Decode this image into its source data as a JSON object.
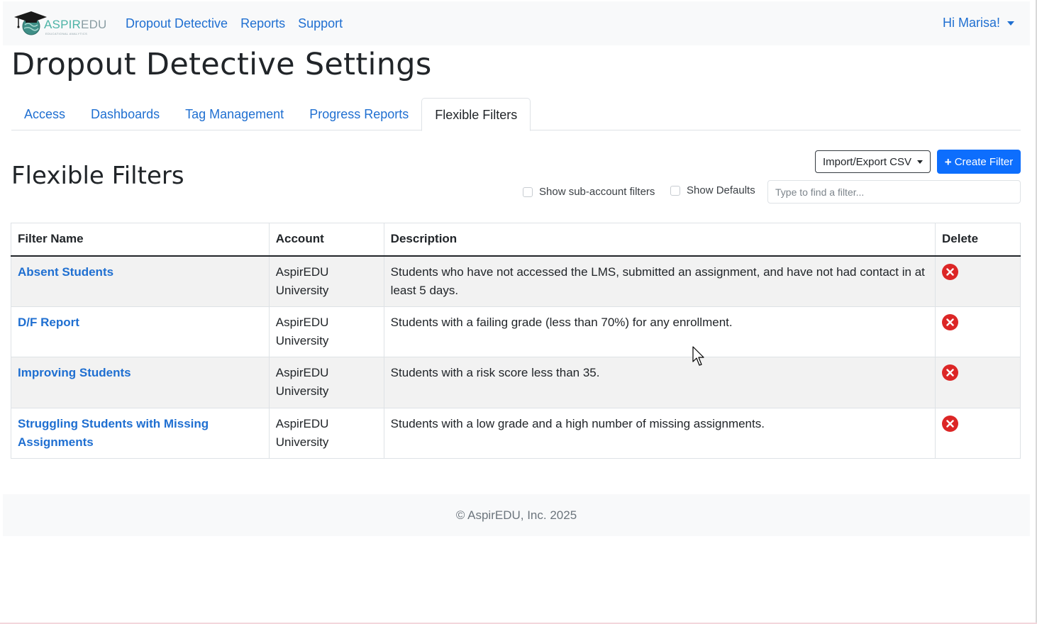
{
  "navbar": {
    "brand": {
      "part1": "ASPIR",
      "part2": "EDU",
      "tagline": "EDUCATIONAL ANALYTICS"
    },
    "links": [
      {
        "label": "Dropout Detective"
      },
      {
        "label": "Reports"
      },
      {
        "label": "Support"
      }
    ],
    "user_greeting": "Hi Marisa!"
  },
  "page_title": "Dropout Detective Settings",
  "tabs": [
    {
      "label": "Access",
      "active": false
    },
    {
      "label": "Dashboards",
      "active": false
    },
    {
      "label": "Tag Management",
      "active": false
    },
    {
      "label": "Progress Reports",
      "active": false
    },
    {
      "label": "Flexible Filters",
      "active": true
    }
  ],
  "section": {
    "title": "Flexible Filters",
    "import_export_label": "Import/Export CSV",
    "create_label": "Create Filter",
    "show_subaccount_label": "Show sub-account filters",
    "show_subaccount_checked": false,
    "show_defaults_label": "Show Defaults",
    "show_defaults_checked": false,
    "search_placeholder": "Type to find a filter...",
    "search_value": ""
  },
  "table": {
    "columns": [
      "Filter Name",
      "Account",
      "Description",
      "Delete"
    ],
    "rows": [
      {
        "name": "Absent Students",
        "account_line1": "AspirEDU",
        "account_line2": "University",
        "description": "Students who have not accessed the LMS, submitted an assignment, and have not had contact in at least 5 days."
      },
      {
        "name": "D/F Report",
        "account_line1": "AspirEDU",
        "account_line2": "University",
        "description": "Students with a failing grade (less than 70%) for any enrollment."
      },
      {
        "name": "Improving Students",
        "account_line1": "AspirEDU",
        "account_line2": "University",
        "description": "Students with a risk score less than 35."
      },
      {
        "name": "Struggling Students with Missing Assignments",
        "account_line1": "AspirEDU",
        "account_line2": "University",
        "description": "Students with a low grade and a high number of missing assignments."
      }
    ]
  },
  "footer": {
    "text": "© AspirEDU, Inc. 2025"
  },
  "icons": {
    "brand": "graduation-cap-globe-icon",
    "delete": "delete-x-circle-icon",
    "create": "plus-icon",
    "cursor": "mouse-pointer-icon"
  },
  "colors": {
    "link": "#1f6fd1",
    "primary": "#0d6efd",
    "danger": "#dc2626",
    "navbar_bg": "#f8f9fa",
    "brand_teal": "#4db3a6"
  }
}
